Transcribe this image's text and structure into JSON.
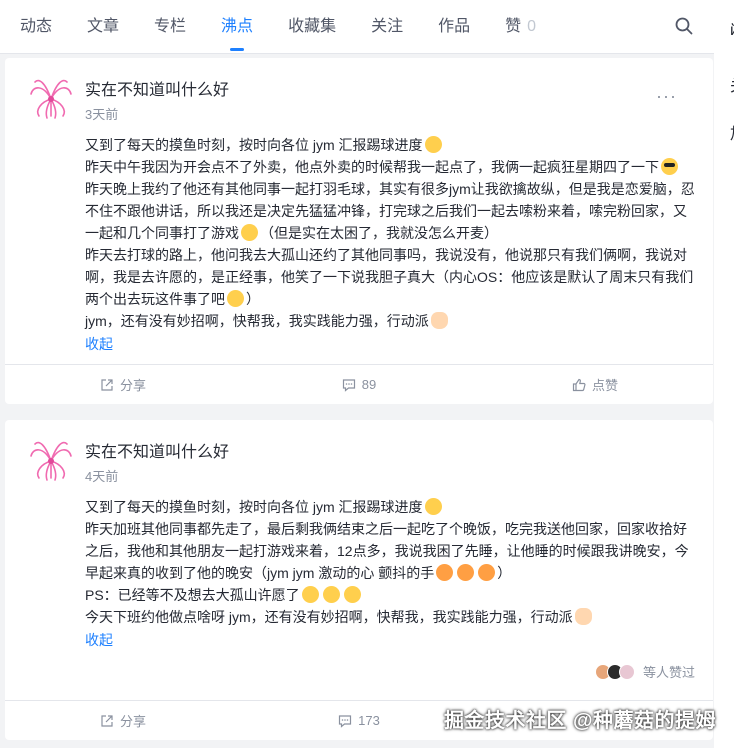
{
  "tabs": [
    {
      "label": "动态"
    },
    {
      "label": "文章"
    },
    {
      "label": "专栏"
    },
    {
      "label": "沸点"
    },
    {
      "label": "收藏集"
    },
    {
      "label": "关注"
    },
    {
      "label": "作品"
    },
    {
      "label": "赞",
      "count": "0"
    }
  ],
  "side_chars": [
    "й",
    "关",
    "加"
  ],
  "posts": [
    {
      "username": "实在不知道叫什么好",
      "time": "3天前",
      "lines": [
        "又到了每天的摸鱼时刻，按时向各位 jym 汇报踢球进度",
        "昨天中午我因为开会点不了外卖，他点外卖的时候帮我一起点了，我俩一起疯狂星期四了一下",
        "昨天晚上我约了他还有其他同事一起打羽毛球，其实有很多jym让我欲擒故纵，但是我是恋爱脑，忍不住不跟他讲话，所以我还是决定先猛猛冲锋，打完球之后我们一起去嗦粉来着，嗦完粉回家，又一起和几个同事打了游戏",
        "（但是实在太困了，我就没怎么开麦）",
        "昨天去打球的路上，他问我去大孤山还约了其他同事吗，我说没有，他说那只有我们俩啊，我说对啊，我是去许愿的，是正经事，他笑了一下说我胆子真大（内心OS：他应该是默认了周末只有我们两个出去玩这件事了吧",
        "）",
        "jym，还有没有妙招啊，快帮我，我实践能力强，行动派"
      ],
      "collapse_label": "收起",
      "share_label": "分享",
      "comment_count": "89",
      "like_label": "点赞"
    },
    {
      "username": "实在不知道叫什么好",
      "time": "4天前",
      "lines": [
        "又到了每天的摸鱼时刻，按时向各位 jym 汇报踢球进度",
        "昨天加班其他同事都先走了，最后剩我俩结束之后一起吃了个晚饭，吃完我送他回家，回家收拾好之后，我他和其他朋友一起打游戏来着，12点多，我说我困了先睡，让他睡的时候跟我讲晚安，今早起来真的收到了他的晚安（jym jym 激动的心 颤抖的手",
        "）",
        "PS：已经等不及想去大孤山许愿了",
        "今天下班约他做点啥呀 jym，还有没有妙招啊，快帮我，我实践能力强，行动派"
      ],
      "collapse_label": "收起",
      "liked_text": "等人赞过",
      "share_label": "分享",
      "comment_count": "173"
    }
  ],
  "watermark": "掘金技术社区 @种蘑菇的提姆"
}
